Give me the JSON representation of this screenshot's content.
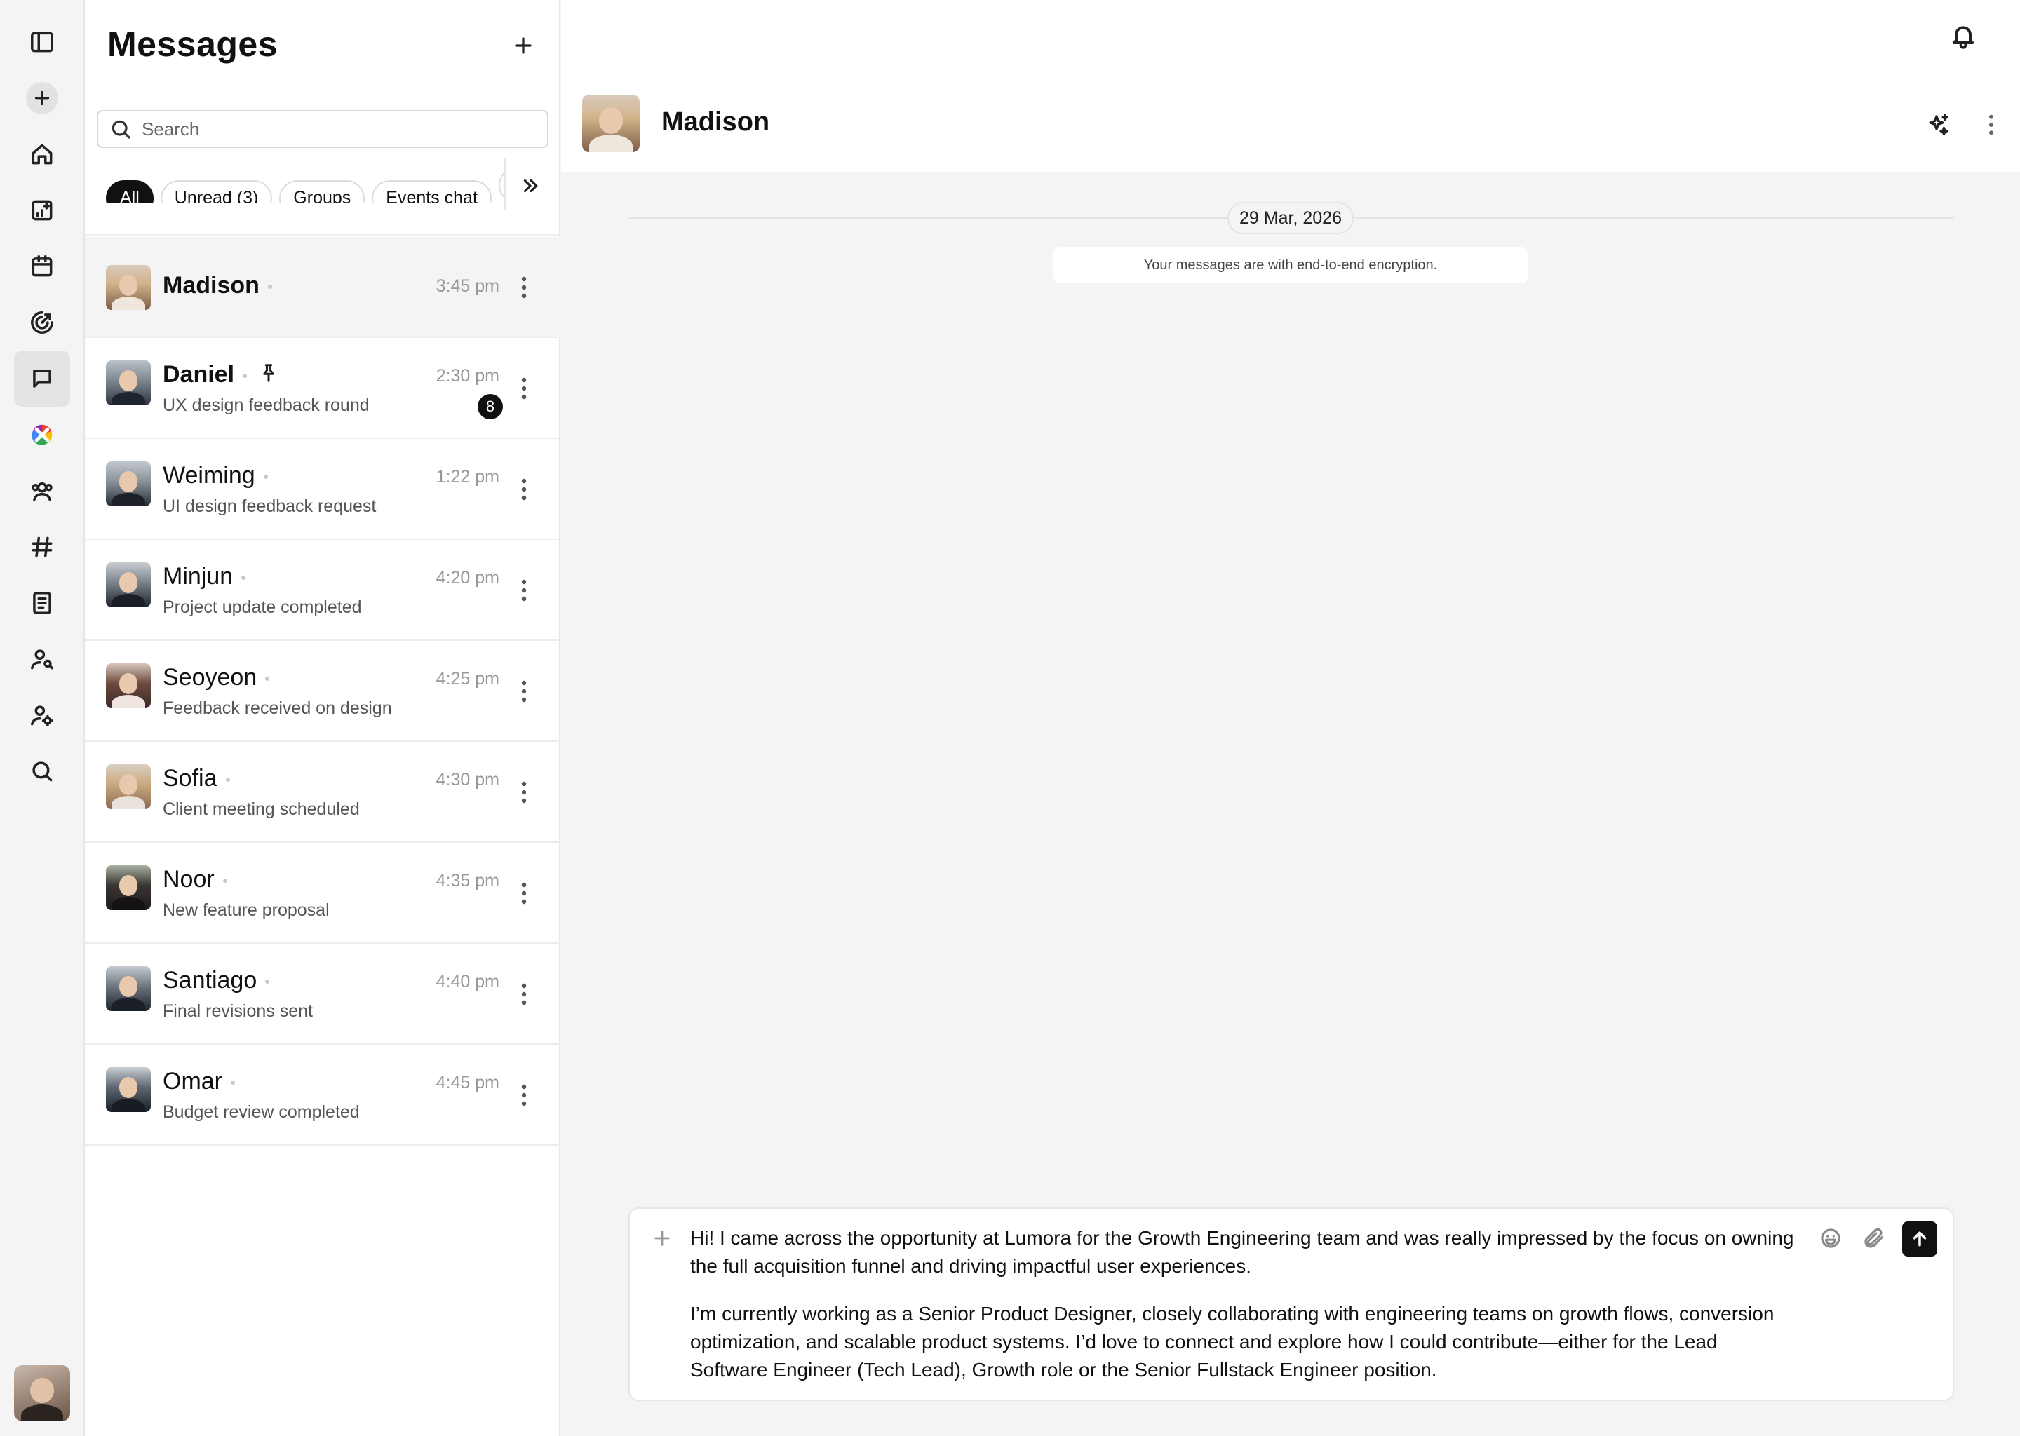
{
  "panel": {
    "title": "Messages",
    "search_placeholder": "Search",
    "filters": [
      "All",
      "Unread (3)",
      "Groups",
      "Events chat",
      ""
    ]
  },
  "conversations": [
    {
      "name": "Madison",
      "preview": "",
      "time": "3:45 pm",
      "badge": "",
      "pinned": false,
      "selected": true
    },
    {
      "name": "Daniel",
      "preview": "UX design feedback round",
      "time": "2:30 pm",
      "badge": "8",
      "pinned": true,
      "selected": false
    },
    {
      "name": "Weiming",
      "preview": "UI design feedback request",
      "time": "1:22 pm",
      "badge": "",
      "pinned": false,
      "selected": false
    },
    {
      "name": "Minjun",
      "preview": "Project update completed",
      "time": "4:20 pm",
      "badge": "",
      "pinned": false,
      "selected": false
    },
    {
      "name": "Seoyeon",
      "preview": "Feedback received on design",
      "time": "4:25 pm",
      "badge": "",
      "pinned": false,
      "selected": false
    },
    {
      "name": "Sofia",
      "preview": "Client meeting scheduled",
      "time": "4:30 pm",
      "badge": "",
      "pinned": false,
      "selected": false
    },
    {
      "name": "Noor",
      "preview": "New feature proposal",
      "time": "4:35 pm",
      "badge": "",
      "pinned": false,
      "selected": false
    },
    {
      "name": "Santiago",
      "preview": "Final revisions sent",
      "time": "4:40 pm",
      "badge": "",
      "pinned": false,
      "selected": false
    },
    {
      "name": "Omar",
      "preview": "Budget review completed",
      "time": "4:45 pm",
      "badge": "",
      "pinned": false,
      "selected": false
    }
  ],
  "chat": {
    "contact_name": "Madison",
    "date": "29 Mar, 2026",
    "encryption_notice": "Your messages are with end-to-end encryption.",
    "draft_paragraph_1": "Hi! I came across the opportunity at Lumora for the Growth Engineering team and was really impressed by the focus on owning the full acquisition funnel and driving impactful user experiences.",
    "draft_paragraph_2": "I’m currently working as a Senior Product Designer, closely collaborating with engineering teams on growth flows, conversion optimization, and scalable product systems. I’d love to connect and explore how I could contribute—either for the Lead Software Engineer (Tech Lead), Growth role or the Senior Fullstack Engineer position."
  },
  "rail_icons": [
    "sidebar-toggle-icon",
    "new-icon",
    "home-icon",
    "reports-icon",
    "calendar-icon",
    "analytics-icon",
    "messages-icon",
    "integrations-icon",
    "team-icon",
    "channels-icon",
    "notes-icon",
    "user-search-icon",
    "user-settings-icon",
    "search-icon"
  ],
  "colors": {
    "accent": "#111111",
    "rail_bg": "#f4f4f4",
    "chat_bg": "#f4f4f4"
  }
}
